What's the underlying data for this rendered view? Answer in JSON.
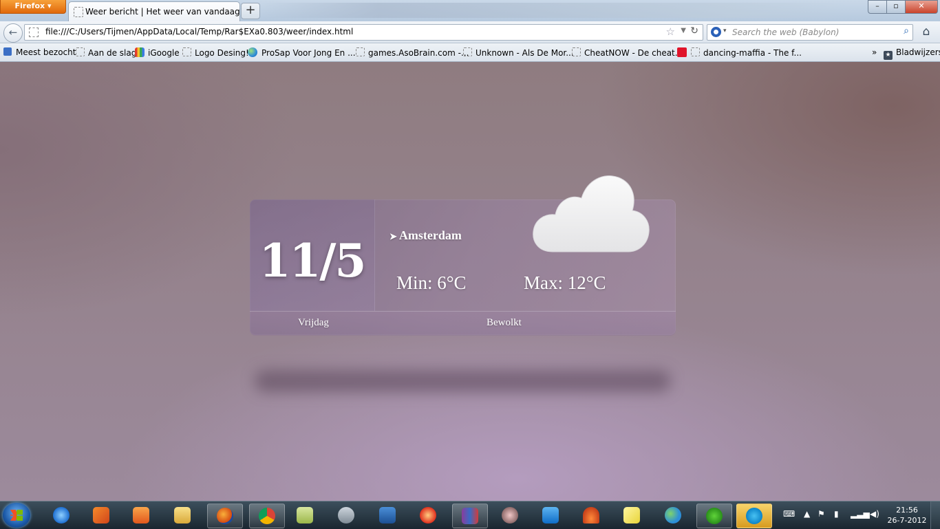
{
  "browser": {
    "app_button": "Firefox",
    "tab_title": "Weer bericht | Het weer van vandaag",
    "new_tab": "+",
    "url": "file:///C:/Users/Tijmen/AppData/Local/Temp/Rar$EXa0.803/weer/index.html",
    "search_placeholder": "Search the web (Babylon)",
    "window_controls": {
      "minimize": "–",
      "maximize": "▫",
      "close": "✕"
    }
  },
  "bookmarks": [
    {
      "label": "Meest bezocht",
      "icon": "bookmark-blue-icon"
    },
    {
      "label": "Aan de slag",
      "icon": "page-icon"
    },
    {
      "label": "iGoogle",
      "icon": "igoogle-icon"
    },
    {
      "label": "Logo Desing!",
      "icon": "page-icon"
    },
    {
      "label": "ProSap Voor Jong En ...",
      "icon": "globe-icon"
    },
    {
      "label": "games.AsoBrain.com -...",
      "icon": "page-icon"
    },
    {
      "label": "Unknown - Als De Mor...",
      "icon": "page-icon"
    },
    {
      "label": "CheatNOW - De cheat...",
      "icon": "page-icon"
    },
    {
      "label": "dancing-maffia - The f...",
      "icon": "page-icon"
    }
  ],
  "bookmarks_more": "»",
  "bookmarks_menu": "Bladwijzers",
  "weather": {
    "date": "11/5",
    "city": "Amsterdam",
    "min": "Min: 6°C",
    "max": "Max: 12°C",
    "day": "Vrijdag",
    "condition": "Bewolkt",
    "condition_icon": "cloud-icon",
    "location_icon": "location-arrow-icon"
  },
  "taskbar": {
    "apps": [
      "internet-explorer",
      "office",
      "media-player",
      "file-explorer",
      "firefox",
      "chrome",
      "notes",
      "satellite",
      "mixer",
      "game",
      "winrar",
      "security",
      "teamviewer",
      "car",
      "sticky-notes",
      "messenger",
      "spotify",
      "skype"
    ],
    "clock_time": "21:56",
    "clock_date": "26-7-2012"
  },
  "colors": {
    "firefox_orange": "#e0680b",
    "close_red": "#c9432c",
    "taskbar": "#1a2630"
  }
}
